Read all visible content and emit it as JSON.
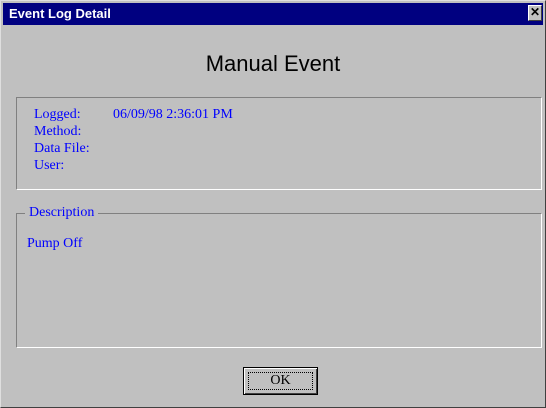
{
  "window": {
    "title": "Event Log Detail",
    "close_glyph": "✕"
  },
  "heading": "Manual Event",
  "details": {
    "logged_label": "Logged:",
    "logged_value": "06/09/98 2:36:01 PM",
    "method_label": "Method:",
    "method_value": "",
    "data_file_label": "Data File:",
    "data_file_value": "",
    "user_label": "User:",
    "user_value": ""
  },
  "description": {
    "legend": "Description",
    "text": "Pump Off"
  },
  "buttons": {
    "ok_label": "OK"
  },
  "colors": {
    "titlebar": "#000080",
    "dialog_background": "#c0c0c0",
    "text_blue": "#0000ff"
  },
  "icons": {
    "close": "close-icon"
  }
}
